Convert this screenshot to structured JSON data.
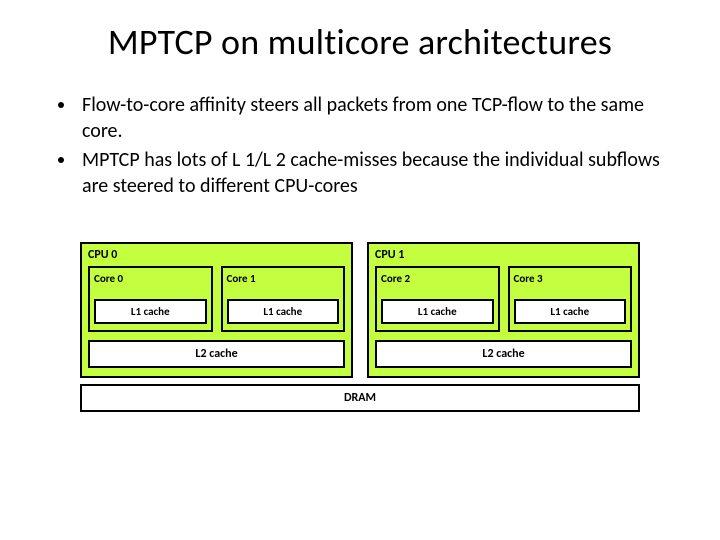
{
  "title": "MPTCP on multicore architectures",
  "bullets": [
    "Flow-to-core affinity steers all packets from one TCP-flow to the same core.",
    "MPTCP has lots of L 1/L 2 cache-misses because the individual subflows are steered to different CPU-cores"
  ],
  "diagram": {
    "cpus": [
      {
        "label": "CPU 0",
        "cores": [
          {
            "label": "Core 0",
            "l1": "L1 cache"
          },
          {
            "label": "Core 1",
            "l1": "L1 cache"
          }
        ],
        "l2": "L2 cache"
      },
      {
        "label": "CPU 1",
        "cores": [
          {
            "label": "Core 2",
            "l1": "L1 cache"
          },
          {
            "label": "Core 3",
            "l1": "L1 cache"
          }
        ],
        "l2": "L2 cache"
      }
    ],
    "dram": "DRAM"
  }
}
